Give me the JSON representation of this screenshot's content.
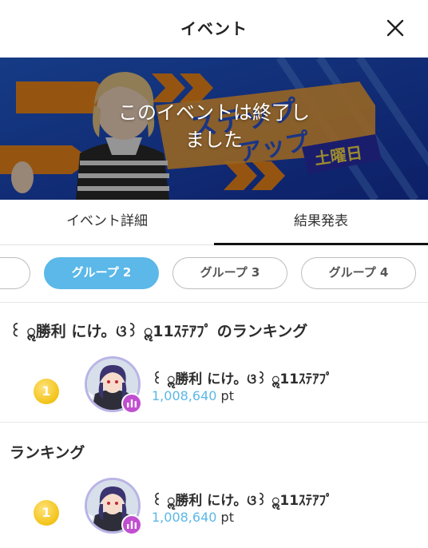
{
  "header": {
    "title": "イベント"
  },
  "banner": {
    "ended_message": "このイベントは終了し\nました",
    "graphic_text_line1": "ステップ",
    "graphic_text_line2": "アップ",
    "graphic_day": "土曜日"
  },
  "tabs": [
    {
      "label": "イベント詳細",
      "active": false
    },
    {
      "label": "結果発表",
      "active": true
    }
  ],
  "groups": [
    {
      "label": "",
      "active": false
    },
    {
      "label": "グループ 2",
      "active": true
    },
    {
      "label": "グループ 3",
      "active": false
    },
    {
      "label": "グループ 4",
      "active": false
    }
  ],
  "group_ranking": {
    "title": "꒰ ॢ勝利 にけ。ଓ꒱ ॢ11ｽﾃｱﾌﾟ のランキング",
    "entries": [
      {
        "rank": "1",
        "name": "꒰ ॢ勝利 にけ。ଓ꒱ ॢ11ｽﾃｱﾌﾟ",
        "points": "1,008,640",
        "unit": "pt"
      }
    ]
  },
  "overall_ranking": {
    "title": "ランキング",
    "entries": [
      {
        "rank": "1",
        "name": "꒰ ॢ勝利 にけ。ଓ꒱ ॢ11ｽﾃｱﾌﾟ",
        "points": "1,008,640",
        "unit": "pt"
      }
    ]
  },
  "colors": {
    "accent": "#5bb8e8",
    "gold_badge": "#f2c318",
    "live_badge": "#c14fd0",
    "banner_blue": "#1f4fc4",
    "banner_orange": "#f08a1c"
  },
  "icons": {
    "close": "close-icon",
    "rank": "rank-medal-icon",
    "live": "live-bars-icon"
  }
}
